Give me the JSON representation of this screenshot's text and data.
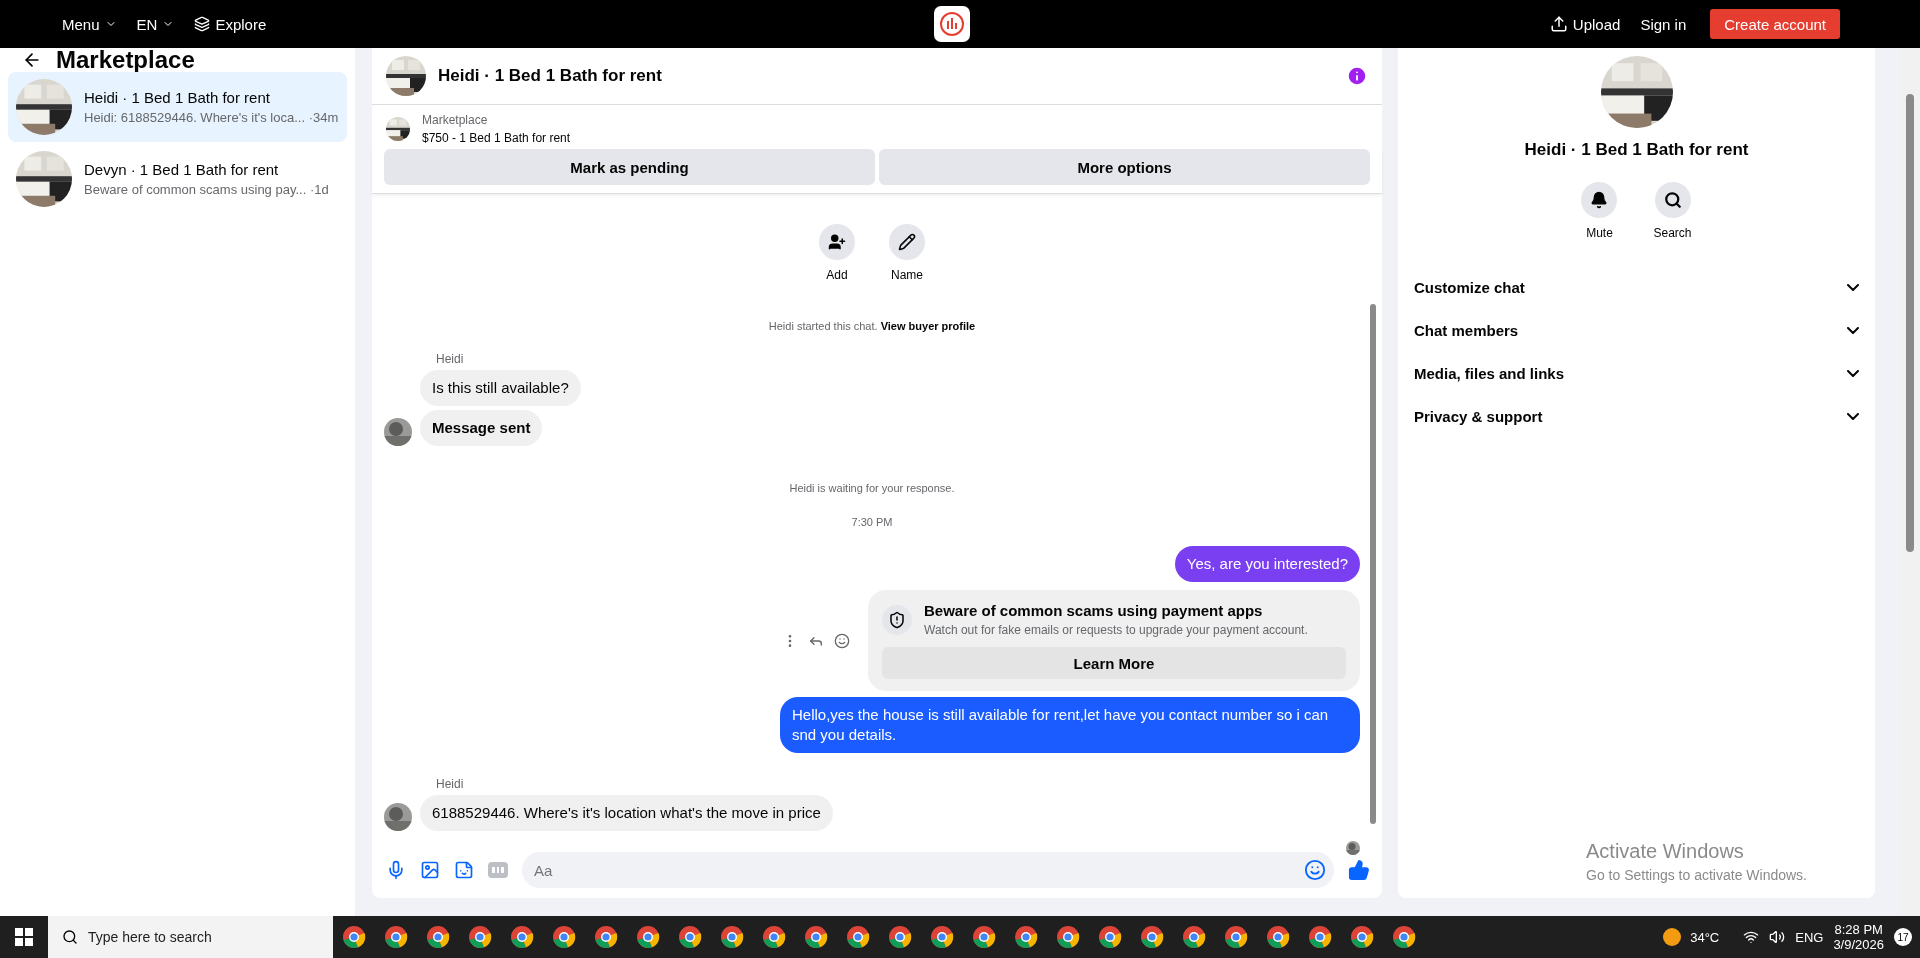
{
  "topbar": {
    "menu": "Menu",
    "language": "EN",
    "explore": "Explore",
    "upload": "Upload",
    "sign_in": "Sign in",
    "create_account": "Create account"
  },
  "sidebar": {
    "title": "Marketplace",
    "items": [
      {
        "title": "Heidi · 1 Bed 1 Bath for rent",
        "preview": "Heidi: 6188529446. Where's it's loca...",
        "time": "·34m",
        "selected": true
      },
      {
        "title": "Devyn · 1 Bed 1 Bath for rent",
        "preview": "Beware of common scams using pay...",
        "time": "·1d",
        "selected": false
      }
    ]
  },
  "chat": {
    "title": "Heidi · 1 Bed 1 Bath for rent",
    "listing": {
      "label": "Marketplace",
      "price": "$750 - 1 Bed 1 Bath for rent"
    },
    "actions": [
      "Mark as pending",
      "More options"
    ],
    "quick_actions": [
      "Add",
      "Name"
    ],
    "messages": [
      {
        "kind": "system",
        "text": "Heidi started this chat.",
        "link": "View buyer profile"
      },
      {
        "kind": "sender",
        "text": "Heidi"
      },
      {
        "kind": "incoming",
        "text": "Is this still available?",
        "avatar": false,
        "bold": false
      },
      {
        "kind": "incoming",
        "text": "Message sent",
        "avatar": true,
        "bold": true
      },
      {
        "kind": "status",
        "text": "Heidi is waiting for your response."
      },
      {
        "kind": "time",
        "text": "7:30 PM"
      },
      {
        "kind": "outgoing",
        "text": "Yes, are you interested?",
        "color": "#7b3ff2"
      },
      {
        "kind": "card",
        "title": "Beware of common scams using payment apps",
        "text": "Watch out for fake emails or requests to upgrade your payment account.",
        "button": "Learn More"
      },
      {
        "kind": "outgoing",
        "text": "Hello,yes the house is still available for rent,let have you contact number so i can snd you details.",
        "color": "#1a5cff"
      },
      {
        "kind": "sender",
        "text": "Heidi"
      },
      {
        "kind": "incoming",
        "text": "6188529446.  Where's it's location what's the move in price",
        "avatar": true,
        "bold": false
      },
      {
        "kind": "seen"
      }
    ],
    "composer": {
      "placeholder": "Aa"
    }
  },
  "details": {
    "title": "Heidi · 1 Bed 1 Bath for rent",
    "actions": [
      "Mute",
      "Search"
    ],
    "sections": [
      {
        "label": "Customize chat",
        "expanded": false
      },
      {
        "label": "Chat members",
        "expanded": false
      },
      {
        "label": "Media, files and links",
        "expanded": false
      },
      {
        "label": "Privacy & support",
        "expanded": false
      }
    ]
  },
  "activation": {
    "title": "Activate Windows",
    "text": "Go to Settings to activate Windows."
  },
  "taskbar": {
    "search_placeholder": "Type here to search",
    "weather": "34°C",
    "language": "ENG",
    "time": "8:28 PM",
    "date": "3/9/2026",
    "notifications": "17"
  }
}
